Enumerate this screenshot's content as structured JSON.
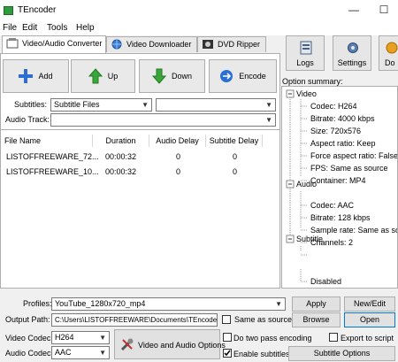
{
  "window": {
    "title": "TEncoder",
    "minimize": "—",
    "maximize": "☐"
  },
  "menu": [
    "File",
    "Edit",
    "Tools",
    "Help"
  ],
  "tabs": [
    {
      "label": "Video/Audio Converter"
    },
    {
      "label": "Video Downloader"
    },
    {
      "label": "DVD Ripper"
    }
  ],
  "toolbar": {
    "add": "Add",
    "up": "Up",
    "down": "Down",
    "encode": "Encode"
  },
  "right_toolbar": {
    "logs": "Logs",
    "settings": "Settings",
    "partial": "Do"
  },
  "subtitles": {
    "label": "Subtitles:",
    "value": "Subtitle Files",
    "second_value": ""
  },
  "audio_track": {
    "label": "Audio Track:",
    "value": ""
  },
  "table": {
    "columns": [
      "File Name",
      "Duration",
      "Audio Delay",
      "Subtitle Delay"
    ],
    "rows": [
      [
        "LISTOFFREEWARE_72...",
        "00:00:32",
        "0",
        "0"
      ],
      [
        "LISTOFFREEWARE_10...",
        "00:00:32",
        "0",
        "0"
      ]
    ]
  },
  "summary": {
    "label": "Option summary:",
    "video": "Video",
    "video_items": [
      "Codec: H264",
      "Bitrate: 4000 kbps",
      "Size: 720x576",
      "Aspect ratio: Keep",
      "Force aspect ratio: False",
      "FPS: Same as source",
      "Container: MP4"
    ],
    "audio": "Audio",
    "audio_items": [
      "Codec: AAC",
      "Bitrate: 128 kbps",
      "Sample rate: Same as sou",
      "Channels: 2"
    ],
    "subtitle": "Subtitle",
    "subtitle_items": [
      "Disabled"
    ]
  },
  "bottom": {
    "profiles_label": "Profiles:",
    "profiles_value": "YouTube_1280x720_mp4",
    "apply": "Apply",
    "new_edit": "New/Edit",
    "output_label": "Output Path:",
    "output_value": "C:\\Users\\LISTOFFREEWARE\\Documents\\TEncoder\\",
    "same_as_source": "Same as source",
    "browse": "Browse",
    "open": "Open",
    "video_codec_label": "Video Codec:",
    "video_codec_value": "H264",
    "audio_codec_label": "Audio Codec:",
    "audio_codec_value": "AAC",
    "va_options": "Video and Audio Options",
    "two_pass": "Do two pass encoding",
    "export_script": "Export to script",
    "enable_subs": "Enable subtitles",
    "subtitle_options": "Subtitle Options"
  },
  "colors": {
    "accent": "#0078d7",
    "up_arrow": "#3aa53a",
    "down_arrow": "#3aa53a",
    "add_icon": "#2a6fd6"
  }
}
